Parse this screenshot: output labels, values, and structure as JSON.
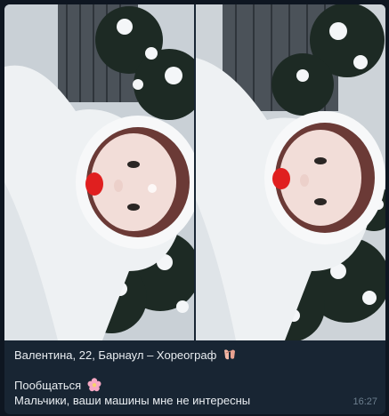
{
  "message": {
    "caption": {
      "line1": "Валентина, 22, Барнаул – Хореограф",
      "line1_emoji": "ballet-shoes-icon",
      "line2": "Пообщаться",
      "line2_emoji": "cherry-blossom-icon",
      "line3": "Мальчики, ваши машины мне не интересны"
    },
    "time": "16:27"
  },
  "media": {
    "count": 2
  },
  "colors": {
    "chat_background": "#0e1621",
    "bubble_background": "#182533",
    "caption_text": "#e9edf1",
    "timestamp_text": "#6d7f8f"
  }
}
